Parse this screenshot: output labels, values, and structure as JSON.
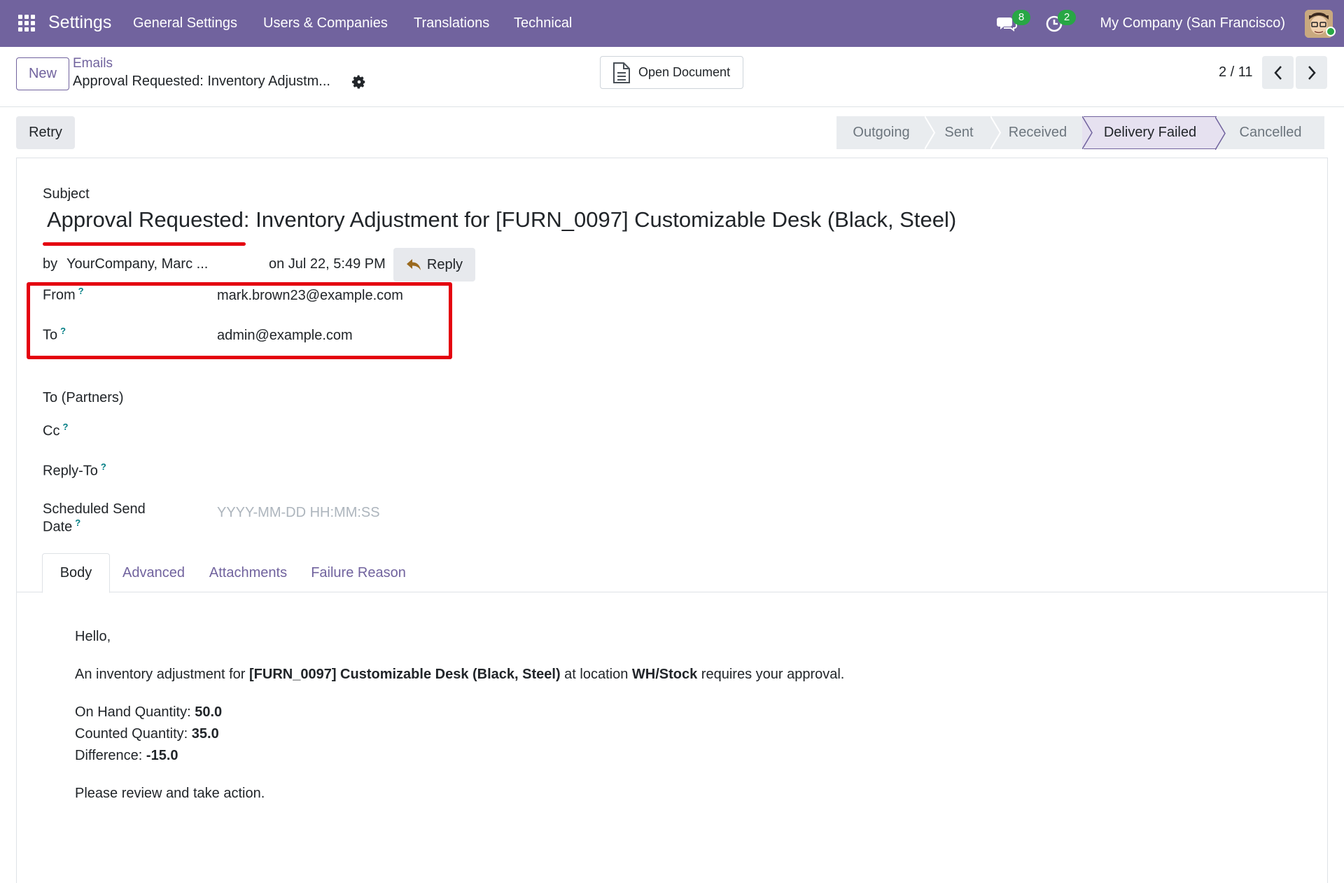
{
  "navbar": {
    "brand": "Settings",
    "menu": [
      "General Settings",
      "Users & Companies",
      "Translations",
      "Technical"
    ],
    "messages_count": "8",
    "activities_count": "2",
    "company": "My Company (San Francisco)"
  },
  "control": {
    "new_label": "New",
    "breadcrumb_parent": "Emails",
    "record_title": "Approval Requested: Inventory Adjustm...",
    "open_document_label": "Open Document",
    "pager_value": "2 / 11"
  },
  "status": {
    "retry_label": "Retry",
    "stages": [
      "Outgoing",
      "Sent",
      "Received",
      "Delivery Failed",
      "Cancelled"
    ],
    "active_stage": "Delivery Failed"
  },
  "form": {
    "subject_label": "Subject",
    "subject_value": "Approval Requested: Inventory Adjustment for [FURN_0097] Customizable Desk (Black, Steel)",
    "by_label": "by",
    "author": "YourCompany, Marc ...",
    "date_text": "on Jul 22, 5:49 PM",
    "reply_label": "Reply",
    "from_label": "From",
    "from_value": "mark.brown23@example.com",
    "to_label": "To",
    "to_value": "admin@example.com",
    "to_partners_label": "To (Partners)",
    "cc_label": "Cc",
    "reply_to_label": "Reply-To",
    "scheduled_label_1": "Scheduled Send",
    "scheduled_label_2": "Date",
    "scheduled_placeholder": "YYYY-MM-DD HH:MM:SS",
    "help_mark": "?"
  },
  "tabs": [
    "Body",
    "Advanced",
    "Attachments",
    "Failure Reason"
  ],
  "body": {
    "greeting": "Hello,",
    "line_pre": "An inventory adjustment for ",
    "product": "[FURN_0097] Customizable Desk (Black, Steel)",
    "line_mid": " at location ",
    "location": "WH/Stock",
    "line_post": " requires your approval.",
    "on_hand_label": "On Hand Quantity: ",
    "on_hand_value": "50.0",
    "counted_label": "Counted Quantity: ",
    "counted_value": "35.0",
    "difference_label": "Difference: ",
    "difference_value": "-15.0",
    "closing": "Please review and take action."
  },
  "colors": {
    "brand": "#71639e",
    "highlight": "#e4000f",
    "badge": "#28a745"
  }
}
